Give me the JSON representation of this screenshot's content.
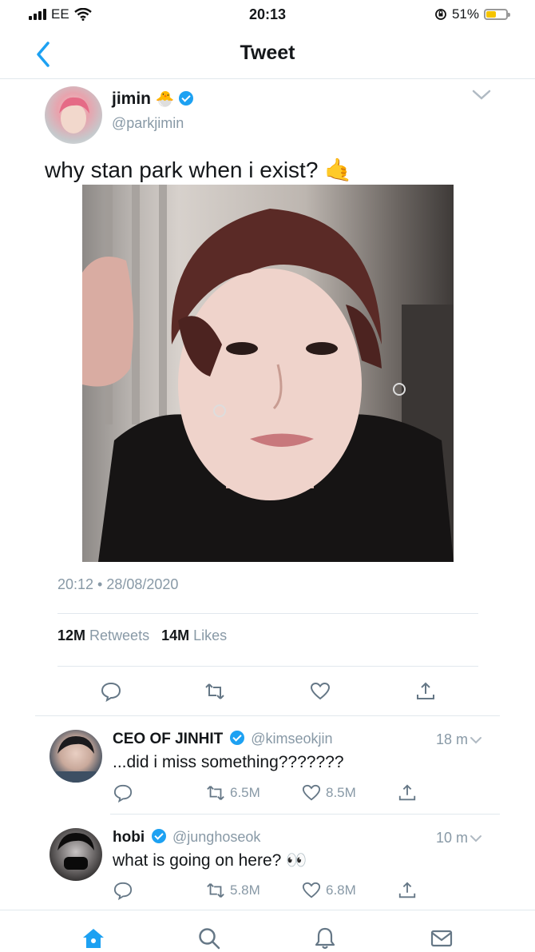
{
  "status_bar": {
    "carrier": "EE",
    "time": "20:13",
    "battery": "51%",
    "battery_level": 0.51
  },
  "nav": {
    "title": "Tweet"
  },
  "tweet": {
    "author_name": "jimin",
    "author_handle": "@parkjimin",
    "text": "why stan park when i exist? 🤙",
    "timestamp": "20:12 • 28/08/2020",
    "retweets_count": "12M",
    "retweets_label": "Retweets",
    "likes_count": "14M",
    "likes_label": "Likes"
  },
  "replies": [
    {
      "name": "CEO OF JINHIT",
      "handle": "@kimseokjin",
      "time": "18 m",
      "text": "...did i miss something???????",
      "retweets": "6.5M",
      "likes": "8.5M"
    },
    {
      "name": "hobi",
      "handle": "@junghoseok",
      "time": "10 m",
      "text": "what is going on here? 👀",
      "retweets": "5.8M",
      "likes": "6.8M"
    }
  ],
  "icons": {
    "back": "chevron-left-icon",
    "more": "chevron-down-icon",
    "reply": "comment-icon",
    "retweet": "retweet-icon",
    "like": "heart-icon",
    "share": "share-icon",
    "home": "home-icon",
    "search": "search-icon",
    "notifications": "bell-icon",
    "messages": "mail-icon"
  },
  "colors": {
    "accent": "#1da1f2",
    "muted": "#8899a6",
    "text": "#14171a",
    "divider": "#e1e8ed"
  }
}
